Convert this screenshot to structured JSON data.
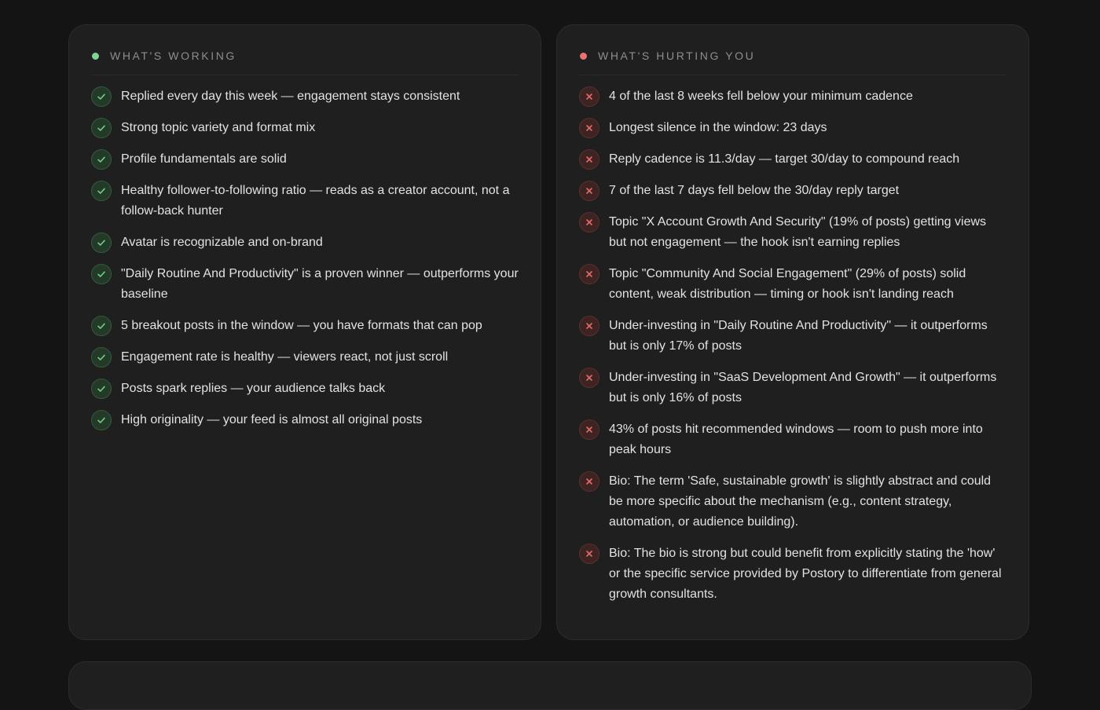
{
  "working": {
    "title": "What's working",
    "accent": "#7fd494",
    "icon": "check-icon",
    "items": [
      "Replied every day this week — engagement stays consistent",
      "Strong topic variety and format mix",
      "Profile fundamentals are solid",
      "Healthy follower-to-following ratio — reads as a creator account, not a follow-back hunter",
      "Avatar is recognizable and on-brand",
      "\"Daily Routine And Productivity\" is a proven winner — outperforms your baseline",
      "5 breakout posts in the window — you have formats that can pop",
      "Engagement rate is healthy — viewers react, not just scroll",
      "Posts spark replies — your audience talks back",
      "High originality — your feed is almost all original posts"
    ]
  },
  "hurting": {
    "title": "What's hurting you",
    "accent": "#ea7272",
    "icon": "x-icon",
    "items": [
      "4 of the last 8 weeks fell below your minimum cadence",
      "Longest silence in the window: 23 days",
      "Reply cadence is 11.3/day — target 30/day to compound reach",
      "7 of the last 7 days fell below the 30/day reply target",
      "Topic \"X Account Growth And Security\" (19% of posts) getting views but not engagement — the hook isn't earning replies",
      "Topic \"Community And Social Engagement\" (29% of posts) solid content, weak distribution — timing or hook isn't landing reach",
      "Under-investing in \"Daily Routine And Productivity\" — it outperforms but is only 17% of posts",
      "Under-investing in \"SaaS Development And Growth\" — it outperforms but is only 16% of posts",
      "43% of posts hit recommended windows — room to push more into peak hours",
      "Bio: The term 'Safe, sustainable growth' is slightly abstract and could be more specific about the mechanism (e.g., content strategy, automation, or audience building).",
      "Bio: The bio is strong but could benefit from explicitly stating the 'how' or the specific service provided by Postory to differentiate from general growth consultants."
    ]
  }
}
